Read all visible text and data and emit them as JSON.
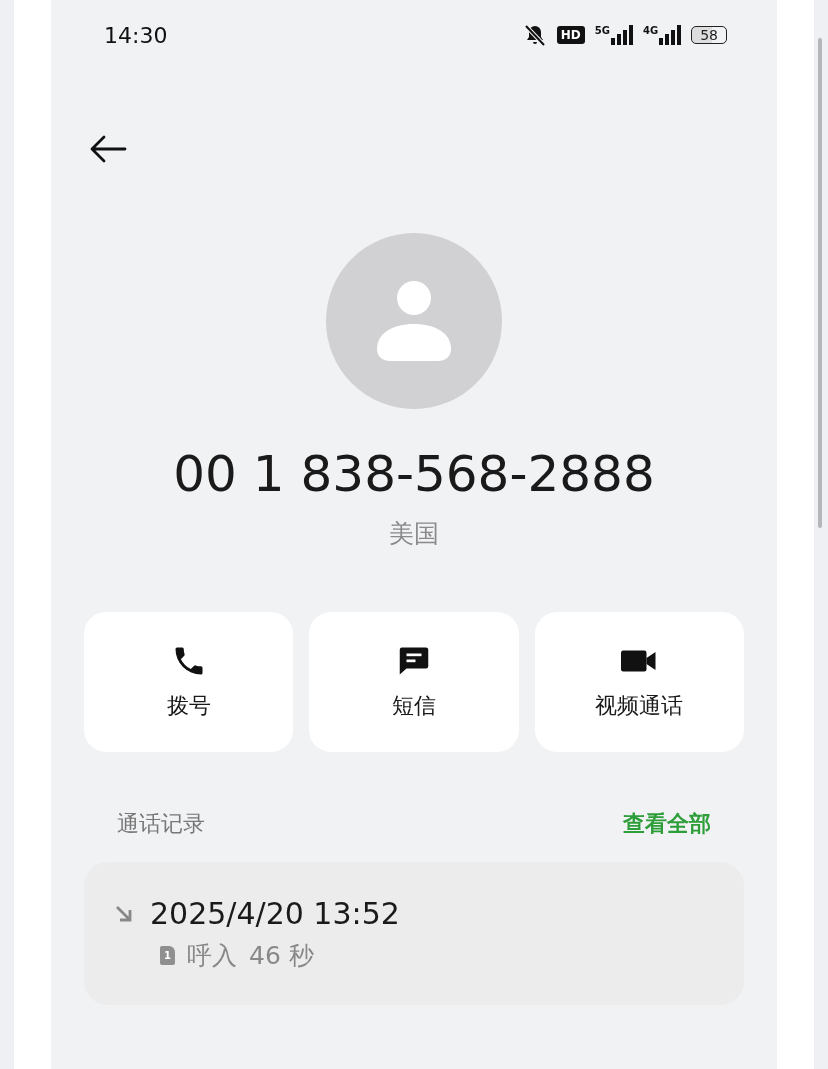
{
  "status_bar": {
    "time": "14:30",
    "hd_label": "HD",
    "network_1": "5G",
    "network_2": "4G",
    "battery": "58"
  },
  "contact": {
    "number": "00 1 838-568-2888",
    "region": "美国"
  },
  "actions": [
    {
      "kind": "call",
      "label": "拨号"
    },
    {
      "kind": "message",
      "label": "短信"
    },
    {
      "kind": "video",
      "label": "视频通话"
    }
  ],
  "call_log": {
    "title": "通话记录",
    "view_all": "查看全部",
    "entries": [
      {
        "kind": "incoming",
        "datetime": "2025/4/20 13:52",
        "sim": "1",
        "type": "呼入",
        "duration": "46 秒"
      }
    ]
  }
}
